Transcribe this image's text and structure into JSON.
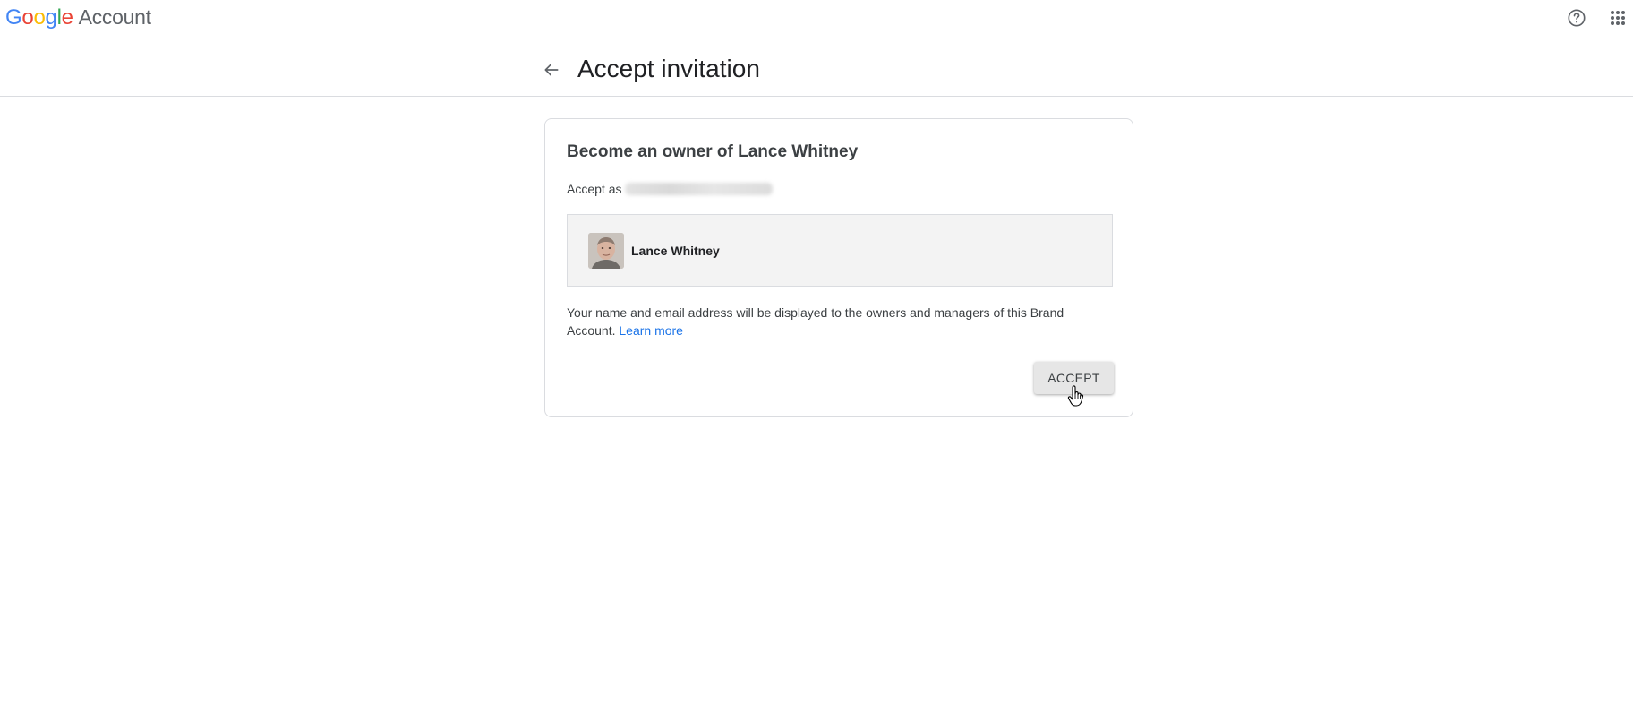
{
  "topbar": {
    "logo_word": "Google",
    "logo_letters": [
      "G",
      "o",
      "o",
      "g",
      "l",
      "e"
    ],
    "logo_colors": [
      "#4285F4",
      "#EA4335",
      "#FBBC05",
      "#4285F4",
      "#34A853",
      "#EA4335"
    ],
    "product_name": "Account",
    "help_icon": "help-circle-icon",
    "apps_icon": "apps-grid-icon"
  },
  "header": {
    "back_icon": "arrow-back-icon",
    "title": "Accept invitation"
  },
  "card": {
    "title": "Become an owner of Lance Whitney",
    "accept_as_label": "Accept as",
    "account": {
      "name": "Lance Whitney"
    },
    "disclaimer_text": "Your name and email address will be displayed to the owners and managers of this Brand Account.",
    "learn_more_label": "Learn more",
    "accept_button_label": "ACCEPT"
  },
  "colors": {
    "link": "#1a73e8",
    "border": "#dadce0",
    "account_box_bg": "#f3f3f3",
    "button_bg": "#e6e6e6"
  }
}
